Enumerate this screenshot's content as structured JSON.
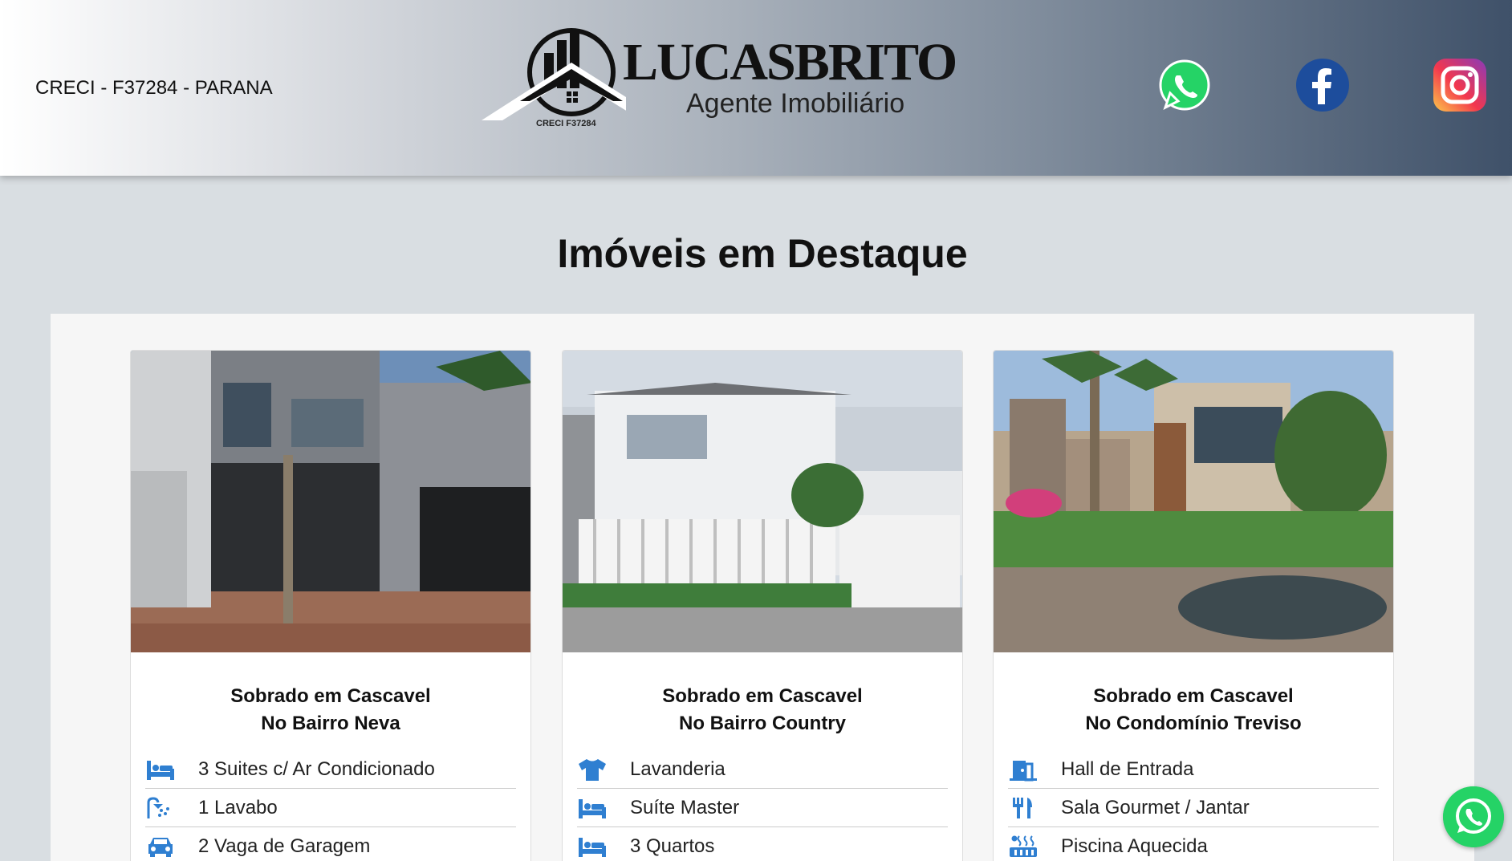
{
  "header": {
    "creci": "CRECI - F37284 - PARANA",
    "logo_name": "LUCASBRITO",
    "logo_subtitle": "Agente Imobiliário",
    "logo_creci": "CRECI F37284",
    "social": [
      "whatsapp-icon",
      "facebook-icon",
      "instagram-icon"
    ]
  },
  "section": {
    "title": "Imóveis em Destaque"
  },
  "cards": [
    {
      "title_line1": "Sobrado em Cascavel",
      "title_line2": "No Bairro Neva",
      "features": [
        {
          "icon": "bed-icon",
          "label": "3 Suites c/ Ar Condicionado"
        },
        {
          "icon": "shower-icon",
          "label": "1 Lavabo"
        },
        {
          "icon": "car-icon",
          "label": "2 Vaga de Garagem"
        }
      ]
    },
    {
      "title_line1": "Sobrado em Cascavel",
      "title_line2": "No Bairro Country",
      "features": [
        {
          "icon": "shirt-icon",
          "label": "Lavanderia"
        },
        {
          "icon": "bed-icon",
          "label": "Suíte Master"
        },
        {
          "icon": "bed-icon",
          "label": "3 Quartos"
        }
      ]
    },
    {
      "title_line1": "Sobrado em Cascavel",
      "title_line2": "No Condomínio Treviso",
      "features": [
        {
          "icon": "door-icon",
          "label": "Hall de Entrada"
        },
        {
          "icon": "utensils-icon",
          "label": "Sala Gourmet / Jantar"
        },
        {
          "icon": "hot-tub-icon",
          "label": "Piscina Aquecida"
        }
      ]
    }
  ],
  "colors": {
    "icon": "#2f7fd1",
    "whatsapp": "#25d366",
    "facebook": "#1d4d9c"
  }
}
